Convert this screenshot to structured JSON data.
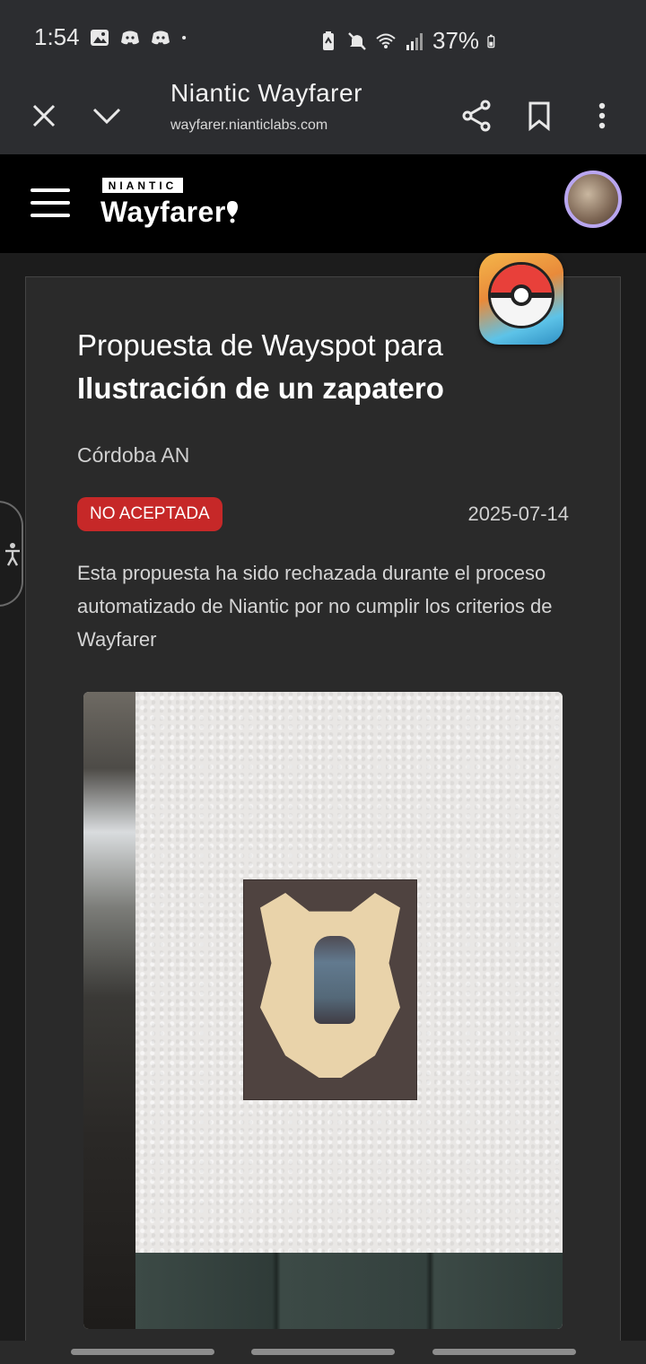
{
  "status_bar": {
    "time": "1:54",
    "battery": "37%",
    "icons": [
      "gallery-icon",
      "discord-icon",
      "discord-icon",
      "dot-icon",
      "battery-saver-icon",
      "mute-icon",
      "wifi-icon",
      "signal-icon",
      "battery-icon"
    ]
  },
  "browser": {
    "title": "Niantic Wayfarer",
    "url": "wayfarer.nianticlabs.com"
  },
  "app": {
    "logo_small": "NIANTIC",
    "logo_big": "Wayfarer"
  },
  "proposal": {
    "title_line1": "Propuesta de Wayspot para",
    "title_line2": "Ilustración de un zapatero",
    "location": "Córdoba AN",
    "status": "NO ACEPTADA",
    "date": "2025-07-14",
    "description": "Esta propuesta ha sido rechazada durante el proceso automatizado de Niantic por no cumplir los criterios de Wayfarer"
  },
  "colors": {
    "status_badge": "#c62828",
    "avatar_ring": "#b9a6f0",
    "app_bar": "#000000",
    "card_bg": "#2a2a2a"
  }
}
